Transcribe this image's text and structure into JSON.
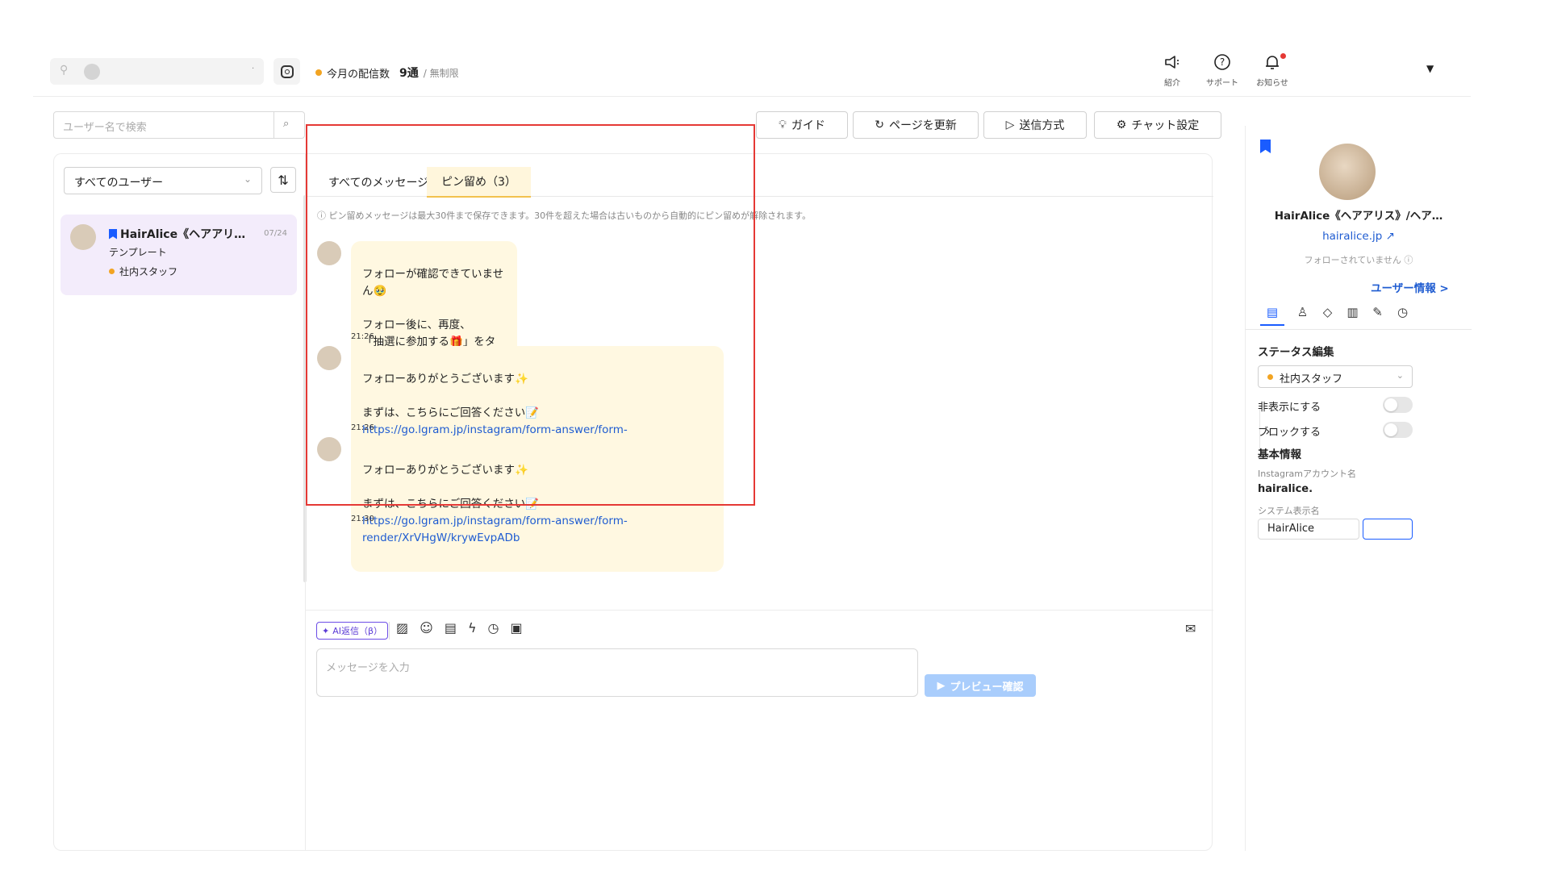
{
  "topbar": {
    "quota_label": "今月の配信数",
    "quota_value": "9通",
    "quota_limit": "/ 無制限",
    "icons": [
      {
        "name": "intro-icon",
        "glyph": "◁:",
        "label": "紹介"
      },
      {
        "name": "support-icon",
        "glyph": "?",
        "label": "サポート"
      },
      {
        "name": "bell-icon",
        "glyph": "♫",
        "label": "お知らせ"
      }
    ]
  },
  "search": {
    "placeholder": "ユーザー名で検索"
  },
  "toolbar": {
    "guide": "ガイド",
    "refresh": "ページを更新",
    "send_method": "送信方式",
    "chat_settings": "チャット設定"
  },
  "sidebar": {
    "filter_value": "すべてのユーザー",
    "chat": {
      "name": "HairAlice《ヘアアリ…",
      "date": "07/24",
      "subtitle": "テンプレート",
      "tag": "社内スタッフ"
    }
  },
  "chat": {
    "tabs": [
      {
        "label": "すべてのメッセージ"
      },
      {
        "label": "ピン留め（3）"
      }
    ],
    "notice": "ⓘ ピン留めメッセージは最大30件まで保存できます。30件を超えた場合は古いものから自動的にピン留めが解除されます。",
    "messages": [
      {
        "text": "フォローが確認できていません🥹\n\nフォロー後に、再度、\n「抽選に参加する🎁」をタップ\nしてくださいね！",
        "link": "",
        "time": "21:26"
      },
      {
        "text": "フォローありがとうございます✨\n\nまずは、こちらにご回答ください📝",
        "link": "https://go.lgram.jp/instagram/form-answer/form-render/XrVHgW/krywEvpADb",
        "time": "21:26"
      },
      {
        "text": "フォローありがとうございます✨\n\nまずは、こちらにご回答ください📝",
        "link": "https://go.lgram.jp/instagram/form-answer/form-render/XrVHgW/krywEvpADb",
        "time": "21:30"
      }
    ],
    "ai_reply": "AI返信（β）",
    "input_placeholder": "メッセージを入力",
    "preview_button": "プレビュー確認"
  },
  "profile": {
    "name": "HairAlice《ヘアアリス》/ヘア…",
    "site": "hairalice.jp",
    "follow_status": "フォローされていません ⓘ",
    "user_info_link": "ユーザー情報 >",
    "status_heading": "ステータス編集",
    "status_value": "社内スタッフ",
    "hide_label": "非表示にする",
    "block_label": "ブロックする",
    "basic_info_heading": "基本情報",
    "instagram_account_label": "Instagramアカウント名",
    "instagram_account_value": "hairalice.",
    "system_name_label": "システム表示名",
    "system_name_value": "HairAlice"
  },
  "colors": {
    "accent_blue": "#1a5cff",
    "highlight_red": "#e53935",
    "bubble_bg": "#fff8e1",
    "status_orange": "#f2a422"
  }
}
